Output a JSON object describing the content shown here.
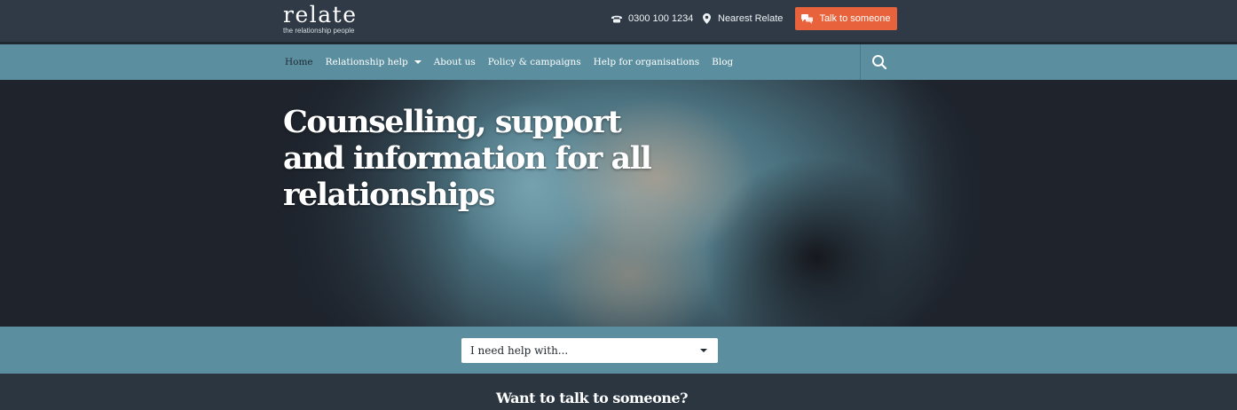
{
  "brand": {
    "logo_text": "relate",
    "tagline": "the relationship people"
  },
  "header": {
    "phone": "0300 100 1234",
    "nearest": "Nearest Relate",
    "cta": "Talk to someone",
    "accent_color": "#e8633b"
  },
  "nav": {
    "items": [
      {
        "label": "Home"
      },
      {
        "label": "Relationship help"
      },
      {
        "label": "About us"
      },
      {
        "label": "Policy & campaigns"
      },
      {
        "label": "Help for organisations"
      },
      {
        "label": "Blog"
      }
    ],
    "search_icon": "search-icon",
    "bar_color": "#5b8fa0"
  },
  "hero": {
    "title": "Counselling, support and information for all relationships"
  },
  "help": {
    "select_value": "I need help with..."
  },
  "footer_section": {
    "title": "Want to talk to someone?"
  }
}
